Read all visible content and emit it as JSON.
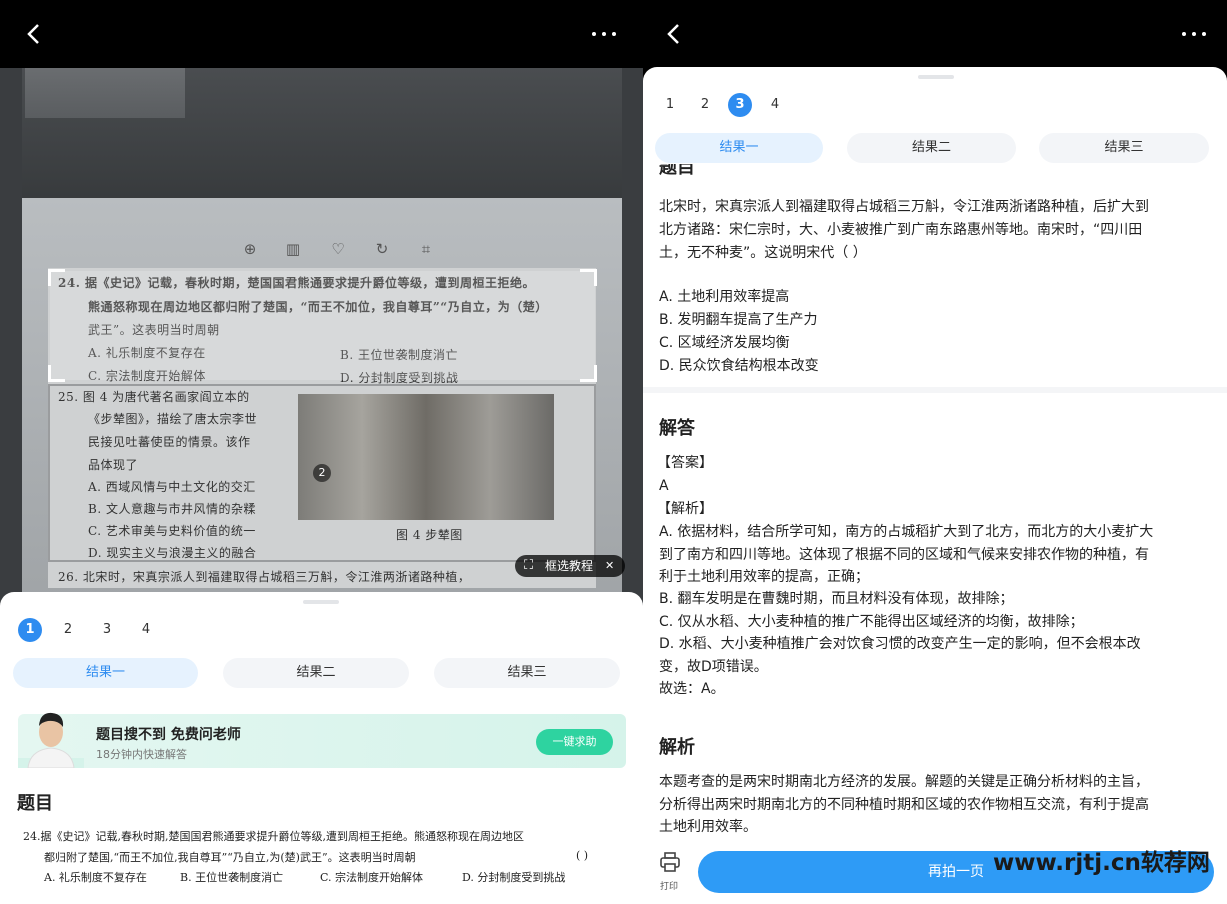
{
  "left": {
    "photo": {
      "q24": [
        "24. 据《史记》记载，春秋时期，楚国国君熊通要求提升爵位等级，遭到周桓王拒绝。",
        "熊通怒称现在周边地区都归附了楚国，“而王不加位，我自尊耳”“乃自立，为（楚）",
        "武王”。这表明当时周朝"
      ],
      "q24_options": [
        "A. 礼乐制度不复存在",
        "B. 王位世袭制度消亡",
        "C. 宗法制度开始解体",
        "D. 分封制度受到挑战"
      ],
      "q25": [
        "25. 图 4 为唐代著名画家阎立本的",
        "《步辇图》，描绘了唐太宗李世",
        "民接见吐蕃使臣的情景。该作",
        "品体现了"
      ],
      "q25_options": [
        "A. 西域风情与中土文化的交汇",
        "B. 文人意趣与市井风情的杂糅",
        "C. 艺术审美与史料价值的统一",
        "D. 现实主义与浪漫主义的融合"
      ],
      "figure_caption": "图 4    步辇图",
      "q26": "26. 北宋时，宋真宗派人到福建取得占城稻三万斛，令江淮两浙诸路种植，",
      "badge": "2",
      "tutorial": "框选教程"
    },
    "pages": [
      "1",
      "2",
      "3",
      "4"
    ],
    "active_page": "1",
    "tabs": [
      "结果一",
      "结果二",
      "结果三"
    ],
    "promo": {
      "title": "题目搜不到 免费问老师",
      "subtitle": "18分钟内快速解答",
      "button": "一键求助"
    },
    "question_heading": "题目",
    "question_lines": [
      "24.据《史记》记载,春秋时期,楚国国君熊通要求提升爵位等级,遭到周桓王拒绝。熊通怒称现在周边地区",
      "都归附了楚国,“而王不加位,我自尊耳”“乃自立,为(楚)武王”。这表明当时周朝"
    ],
    "question_bracket": "(        )",
    "question_options": [
      "A. 礼乐制度不复存在",
      "B. 王位世袭制度消亡",
      "C. 宗法制度开始解体",
      "D. 分封制度受到挑战"
    ]
  },
  "right": {
    "pages": [
      "1",
      "2",
      "3",
      "4"
    ],
    "active_page": "3",
    "tabs": [
      "结果一",
      "结果二",
      "结果三"
    ],
    "partial_heading": "题目",
    "question_lines": [
      "北宋时，宋真宗派人到福建取得占城稻三万斛，令江淮两浙诸路种植，后扩大到",
      "北方诸路：宋仁宗时，大、小麦被推广到广南东路惠州等地。南宋时，“四川田",
      "土，无不种麦”。这说明宋代（ ）"
    ],
    "options": [
      "A. 土地利用效率提高",
      "B. 发明翻车提高了生产力",
      "C. 区域经济发展均衡",
      "D. 民众饮食结构根本改变"
    ],
    "answer_heading": "解答",
    "answer_lines": [
      "【答案】",
      "A",
      "【解析】",
      "A. 依据材料，结合所学可知，南方的占城稻扩大到了北方，而北方的大小麦扩大",
      "到了南方和四川等地。这体现了根据不同的区域和气候来安排农作物的种植，有",
      "利于土地利用效率的提高，正确；",
      "B. 翻车发明是在曹魏时期，而且材料没有体现，故排除；",
      "C. 仅从水稻、大小麦种植的推广不能得出区域经济的均衡，故排除；",
      "D. 水稻、大小麦种植推广会对饮食习惯的改变产生一定的影响，但不会根本改",
      "变，故D项错误。",
      "故选：A。"
    ],
    "analysis_heading": "解析",
    "analysis_lines": [
      "本题考查的是两宋时期南北方经济的发展。解题的关键是正确分析材料的主旨，",
      "分析得出两宋时期南北方的不同种植时期和区域的农作物相互交流，有利于提高",
      "土地利用效率。"
    ],
    "print_label": "打印",
    "retake_button": "再拍一页"
  },
  "watermark": "www.rjtj.cn软荐网",
  "colors": {
    "accent": "#2e8cf0",
    "help_button": "#2ed3a0",
    "retake_button": "#2e9bf6"
  }
}
